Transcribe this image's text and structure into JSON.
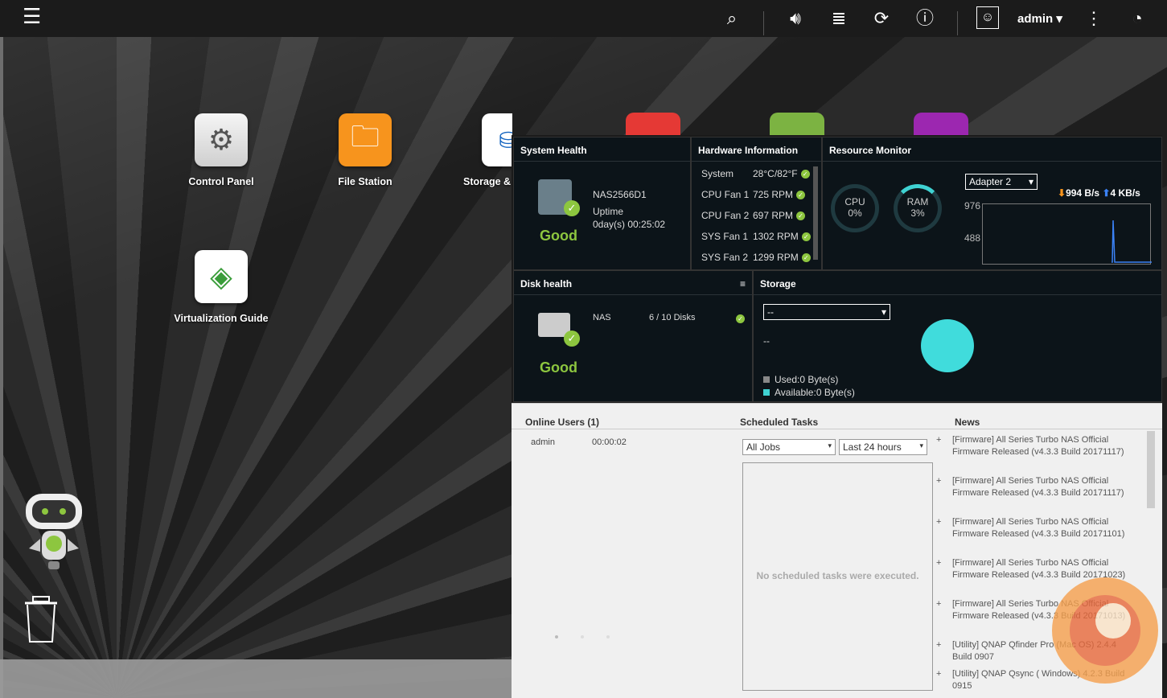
{
  "topbar": {
    "menu_icon": "menu-icon",
    "user": "admin"
  },
  "desktop": {
    "icons": [
      {
        "label": "Control Panel",
        "icon": "gear-icon",
        "color": "#e6e6e6"
      },
      {
        "label": "File Station",
        "icon": "folder-icon",
        "color": "#f7941d"
      },
      {
        "label": "Storage & S",
        "icon": "storage-icon",
        "color": "#ffffff"
      },
      {
        "label": "Virtualization Guide",
        "icon": "cube-icon",
        "color": "#ffffff"
      }
    ]
  },
  "system_health": {
    "title": "System Health",
    "device": "NAS2566D1",
    "uptime_label": "Uptime",
    "uptime": "0day(s) 00:25:02",
    "status": "Good"
  },
  "hardware": {
    "title": "Hardware Information",
    "rows": [
      {
        "name": "System",
        "value": "28°C/82°F"
      },
      {
        "name": "CPU Fan 1",
        "value": "725 RPM"
      },
      {
        "name": "CPU Fan 2",
        "value": "697 RPM"
      },
      {
        "name": "SYS Fan 1",
        "value": "1302 RPM"
      },
      {
        "name": "SYS Fan 2",
        "value": "1299 RPM"
      }
    ]
  },
  "resource": {
    "title": "Resource Monitor",
    "cpu_label": "CPU",
    "cpu": "0%",
    "ram_label": "RAM",
    "ram": "3%",
    "adapter": "Adapter 2",
    "down": "994 B/s",
    "up": "4 KB/s",
    "y1": "976",
    "y2": "488"
  },
  "disk": {
    "title": "Disk health",
    "name": "NAS",
    "disks": "6 / 10 Disks",
    "status": "Good"
  },
  "storage": {
    "title": "Storage",
    "select": "--",
    "dash": "--",
    "used": "Used:0 Byte(s)",
    "available": "Available:0 Byte(s)"
  },
  "online": {
    "title": "Online Users (1)",
    "user": "admin",
    "time": "00:00:02"
  },
  "scheduled": {
    "title": "Scheduled Tasks",
    "filter1": "All Jobs",
    "filter2": "Last 24 hours",
    "empty": "No scheduled tasks were executed."
  },
  "news": {
    "title": "News",
    "items": [
      "[Firmware] All Series Turbo NAS Official Firmware Released (v4.3.3 Build 20171117)",
      "[Firmware] All Series Turbo NAS Official Firmware Released (v4.3.3 Build 20171117)",
      "[Firmware] All Series Turbo NAS Official Firmware Released (v4.3.3 Build 20171101)",
      "[Firmware] All Series Turbo NAS Official Firmware Released (v4.3.3 Build 20171023)",
      "[Firmware] All Series Turbo NAS Official Firmware Released (v4.3.3 Build 20171013)",
      "[Utility] QNAP Qfinder Pro (Mac OS) 2.4.4 Build 0907",
      "[Utility] QNAP Qsync ( Windows) 4.2.3 Build 0915"
    ]
  }
}
